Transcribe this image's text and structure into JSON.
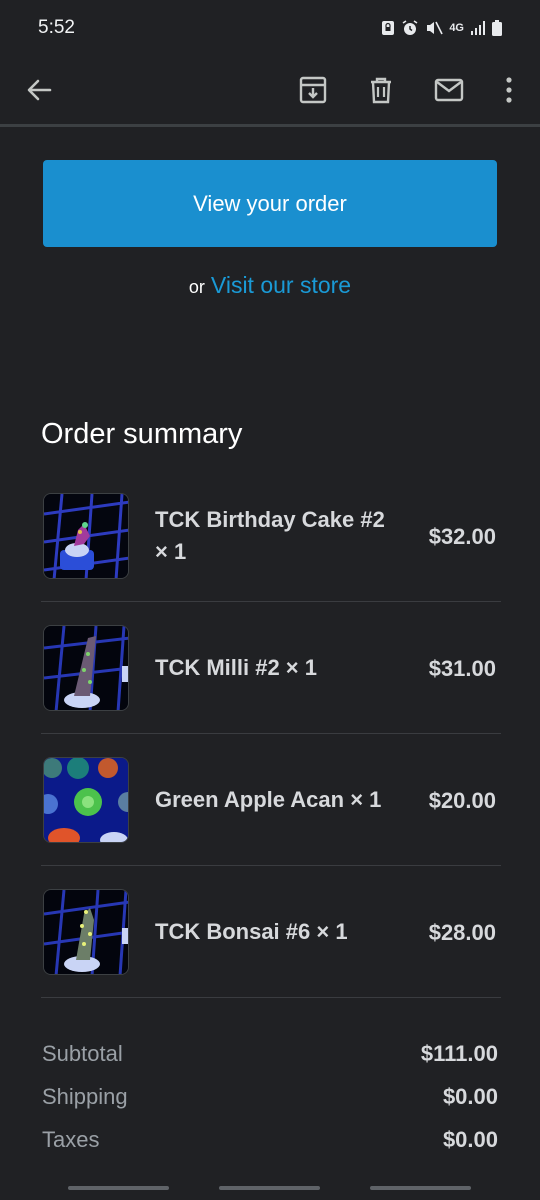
{
  "status": {
    "time": "5:52",
    "network": "4G"
  },
  "toolbar": {
    "back": "back-arrow-icon",
    "archive": "archive-icon",
    "delete": "delete-icon",
    "mark_unread": "mail-icon",
    "more": "more-vert-icon"
  },
  "cta": {
    "view_order_label": "View your order",
    "or_text": "or",
    "visit_store_label": "Visit our store"
  },
  "summary": {
    "title": "Order summary",
    "items": [
      {
        "name": "TCK Birthday Cake #2 × 1",
        "price": "$32.00"
      },
      {
        "name": "TCK Milli #2 × 1",
        "price": "$31.00"
      },
      {
        "name": "Green Apple Acan × 1",
        "price": "$20.00"
      },
      {
        "name": "TCK Bonsai #6 × 1",
        "price": "$28.00"
      }
    ]
  },
  "totals": {
    "subtotal_label": "Subtotal",
    "subtotal_value": "$111.00",
    "shipping_label": "Shipping",
    "shipping_value": "$0.00",
    "taxes_label": "Taxes",
    "taxes_value": "$0.00"
  },
  "colors": {
    "accent": "#1a8fcf",
    "link": "#1a9ad6",
    "background": "#202124"
  }
}
